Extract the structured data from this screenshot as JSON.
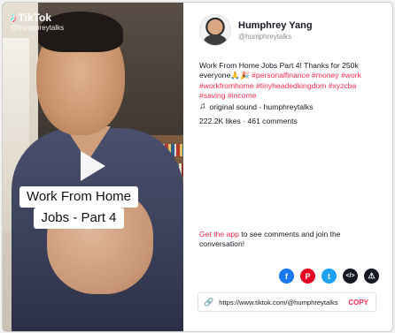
{
  "video": {
    "brand": "TikTok",
    "brand_icon": "tiktok-note-icon",
    "handle": "@humphreytalks",
    "caption_lines": [
      "Work From Home",
      "Jobs - Part 4"
    ],
    "play_icon": "play-icon"
  },
  "author": {
    "name": "Humphrey Yang",
    "handle": "@humphreytalks"
  },
  "description": {
    "text": "Work From Home Jobs Part 4! Thanks for 250k everyone🙏🎉 ",
    "hashtags": [
      "#personalfinance",
      "#money",
      "#work",
      "#workfromhome",
      "#tinyheadedkingdom",
      "#xyzcba",
      "#saving",
      "#income"
    ]
  },
  "sound": {
    "icon": "music-note-icon",
    "label": "original sound - humphreytalks"
  },
  "stats": {
    "text": "222.2K likes · 461 comments"
  },
  "get_app": {
    "link": "Get the app",
    "rest": " to see comments and join the conversation!"
  },
  "share": [
    {
      "name": "facebook-icon",
      "glyph": "f"
    },
    {
      "name": "pinterest-icon",
      "glyph": "P"
    },
    {
      "name": "twitter-icon",
      "glyph": "t"
    },
    {
      "name": "embed-icon",
      "glyph": "</>"
    },
    {
      "name": "report-icon",
      "glyph": "⚠"
    }
  ],
  "link": {
    "url": "https://www.tiktok.com/@humphreytalks",
    "copy_label": "COPY"
  },
  "colors": {
    "accent": "#fe2c55",
    "text": "#161823",
    "muted": "#8a8b91"
  }
}
